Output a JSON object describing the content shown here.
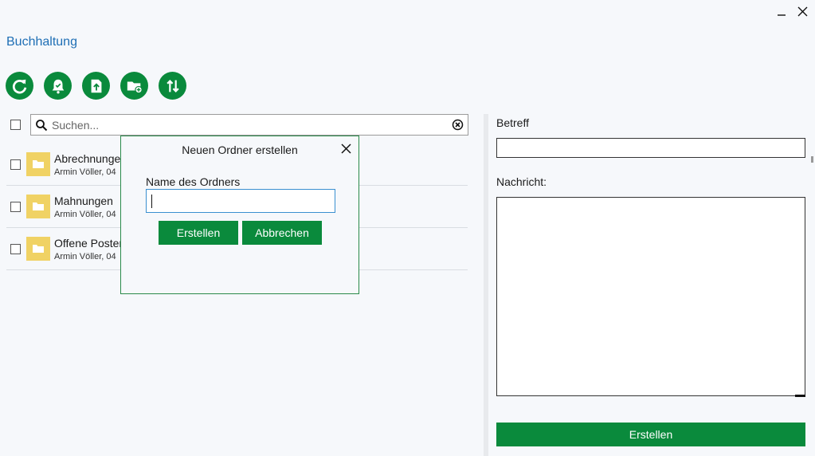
{
  "app": {
    "title": "Buchhaltung"
  },
  "window": {
    "minimize_icon": "minimize-icon",
    "close_icon": "close-icon"
  },
  "toolbar": {
    "buttons": [
      {
        "icon": "refresh-icon"
      },
      {
        "icon": "notification-icon"
      },
      {
        "icon": "upload-icon"
      },
      {
        "icon": "new-folder-icon"
      },
      {
        "icon": "sort-icon"
      }
    ]
  },
  "search": {
    "placeholder": "Suchen..."
  },
  "folders": [
    {
      "name": "Abrechnungen",
      "meta": "Armin Völler, 04"
    },
    {
      "name": "Mahnungen",
      "meta": "Armin Völler, 04"
    },
    {
      "name": "Offene Posten",
      "meta": "Armin Völler, 04"
    }
  ],
  "detail": {
    "subject_label": "Betreff",
    "message_label": "Nachricht:",
    "create_label": "Erstellen"
  },
  "dialog": {
    "title": "Neuen Ordner erstellen",
    "name_label": "Name des Ordners",
    "name_value": "",
    "create_label": "Erstellen",
    "cancel_label": "Abbrechen"
  },
  "colors": {
    "accent": "#0a8a3c",
    "title_blue": "#1f6fb5",
    "folder": "#f0d264"
  }
}
